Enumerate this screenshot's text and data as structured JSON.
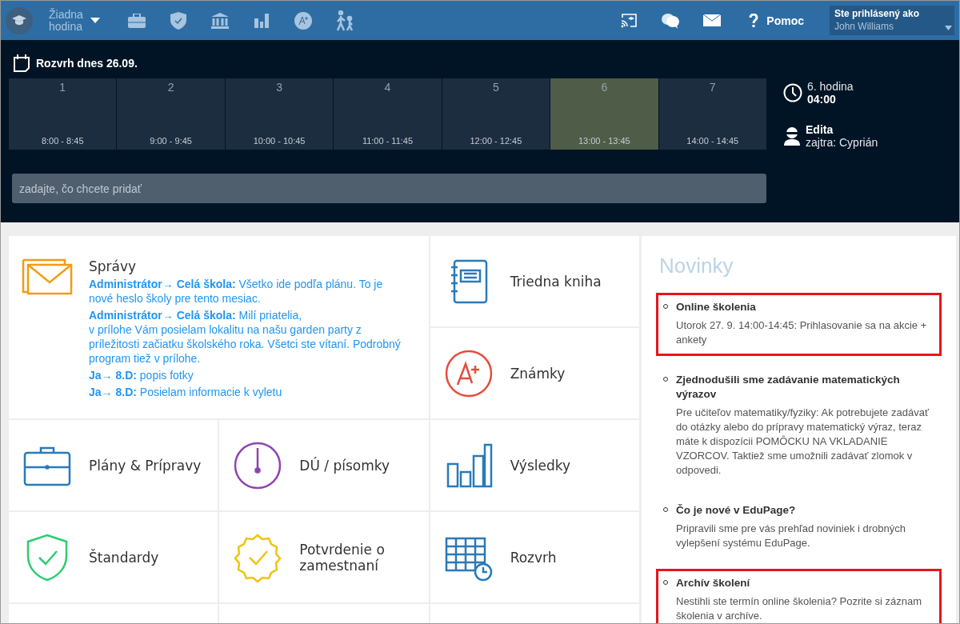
{
  "topbar": {
    "lesson_label": "Žiadna hodina",
    "help": "Pomoc",
    "user_caption": "Ste prihlásený ako",
    "user_name": "John Williams"
  },
  "schedule": {
    "title": "Rozvrh dnes 26.09.",
    "lessons": [
      {
        "number": "1",
        "time": "8:00 - 8:45",
        "selected": false
      },
      {
        "number": "2",
        "time": "9:00 - 9:45",
        "selected": false
      },
      {
        "number": "3",
        "time": "10:00 - 10:45",
        "selected": false
      },
      {
        "number": "4",
        "time": "11:00 - 11:45",
        "selected": false
      },
      {
        "number": "5",
        "time": "12:00 - 12:45",
        "selected": false
      },
      {
        "number": "6",
        "time": "13:00 - 13:45",
        "selected": true
      },
      {
        "number": "7",
        "time": "14:00 - 14:45",
        "selected": false
      }
    ],
    "current": {
      "lesson": "6. hodina",
      "time": "04:00"
    },
    "substitute": {
      "name": "Edita",
      "note": "zajtra: Cyprián"
    },
    "input": {
      "placeholder": "zadajte, čo chcete pridať"
    }
  },
  "tiles": [
    {
      "kind": "messages",
      "title": "Správy",
      "messages": [
        "**Administrátor→ Celá škola:** Všetko ide podľa plánu. To je nové heslo školy pre tento mesiac.",
        "**Administrátor→ Celá škola:** Milí priatelia,\nv prílohe Vám posielam lokalitu na našu garden party z príležitosti začiatku školského roka. Všetci ste vítaní. Podrobný program tiež v prílohe.",
        "**Ja→ 8.D:** popis fotky",
        "**Ja→ 8.D:** Posielam informacie k vyletu"
      ]
    },
    {
      "kind": "classbook",
      "title": "Triedna kniha"
    },
    {
      "kind": "grades",
      "title": "Známky"
    },
    {
      "kind": "plans",
      "title": "Plány & Prípravy"
    },
    {
      "kind": "homework",
      "title": "DÚ / písomky"
    },
    {
      "kind": "results",
      "title": "Výsledky"
    },
    {
      "kind": "standards",
      "title": "Štandardy"
    },
    {
      "kind": "certificate",
      "title": "Potvrdenie o zamestnaní"
    },
    {
      "kind": "timetable",
      "title": "Rozvrh"
    }
  ],
  "news": {
    "title": "Novinky",
    "items": [
      {
        "title": "Online školenia",
        "text": "Utorok 27. 9. 14:00-14:45: Prihlasovanie sa na akcie + ankety",
        "highlighted": true
      },
      {
        "title": "Zjednodušili sme zadávanie matematických výrazov",
        "text": "Pre učiteľov matematiky/fyziky: Ak potrebujete zadávať do otázky alebo do prípravy matematický výraz, teraz máte k dispozícii POMÔCKU NA VKLADANIE VZORCOV. Taktiež sme umožnili zadávať zlomok v odpovedi.",
        "highlighted": false
      },
      {
        "title": "Čo je nové v EduPage?",
        "text": "Pripravili sme pre vás prehľad noviniek i drobných vylepšení systému EduPage.",
        "highlighted": false
      },
      {
        "title": "Archív školení",
        "text": "Nestihli ste termín online školenia? Pozrite si záznam školenia v archíve.",
        "highlighted": true
      }
    ]
  }
}
